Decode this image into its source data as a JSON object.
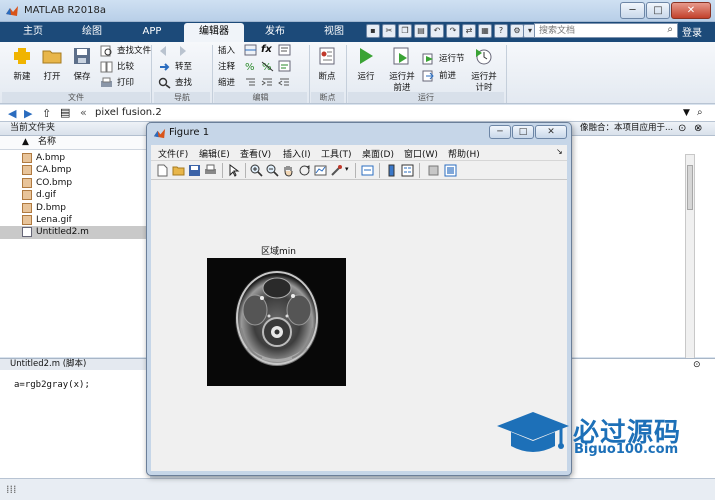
{
  "window": {
    "title": "MATLAB R2018a",
    "minimize": "─",
    "maximize": "□",
    "close": "✕"
  },
  "tabs": [
    {
      "label": "主页"
    },
    {
      "label": "绘图"
    },
    {
      "label": "APP"
    },
    {
      "label": "编辑器",
      "active": true
    },
    {
      "label": "发布"
    },
    {
      "label": "视图"
    }
  ],
  "search": {
    "placeholder": "搜索文档",
    "icon": "search-icon"
  },
  "login": "登录",
  "ribbon": {
    "file": {
      "new": "新建",
      "open": "打开",
      "save": "保存",
      "find_files": "查找文件",
      "compare": "比较",
      "print": "打印",
      "group": "文件"
    },
    "navigate": {
      "goto": "转至",
      "find": "查找",
      "group": "导航"
    },
    "edit": {
      "insert": "插入",
      "comment": "注释",
      "indent": "缩进",
      "fx": "fx",
      "group": "编辑"
    },
    "breakpoints": {
      "breakpoints": "断点",
      "group": "断点"
    },
    "run": {
      "run": "运行",
      "run_advance_l1": "运行并",
      "run_advance_l2": "前进",
      "run_section": "运行节",
      "advance": "前进",
      "run_time_l1": "运行并",
      "run_time_l2": "计时",
      "group": "运行"
    }
  },
  "address": {
    "path": "pixel fusion.2",
    "chevron": "«"
  },
  "current_folder": {
    "header": "当前文件夹",
    "column": "名称",
    "sort_arrow": "▲",
    "files": [
      {
        "name": "A.bmp"
      },
      {
        "name": "CA.bmp"
      },
      {
        "name": "CO.bmp"
      },
      {
        "name": "d.gif"
      },
      {
        "name": "D.bmp"
      },
      {
        "name": "Lena.gif"
      },
      {
        "name": "Untitled2.m",
        "selected": true
      }
    ]
  },
  "editor": {
    "header": "Untitled2.m  (脚本)",
    "code": "a=rgb2gray(x);"
  },
  "right_panel": {
    "header": "像融合：本项目应用于..."
  },
  "figure": {
    "title": "Figure 1",
    "menus": [
      "文件(F)",
      "编辑(E)",
      "查看(V)",
      "插入(I)",
      "工具(T)",
      "桌面(D)",
      "窗口(W)",
      "帮助(H)"
    ],
    "axes_title": "区域min"
  },
  "watermark": {
    "zh": "必过源码",
    "en": "Biguo100.com"
  },
  "colors": {
    "ribbon_tab_bg": "#1c4a79",
    "watermark": "#1d70b8"
  }
}
